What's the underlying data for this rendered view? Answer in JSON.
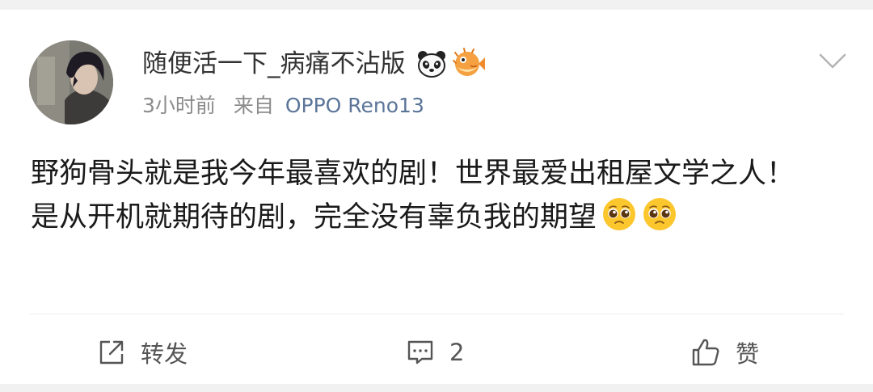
{
  "post": {
    "author": "随便活一下_病痛不沾版",
    "author_badges": [
      "panda-icon",
      "pufferfish-icon"
    ],
    "time": "3小时前",
    "source_prefix": "来自",
    "device": "OPPO Reno13",
    "content_lines": [
      "野狗骨头就是我今年最喜欢的剧！世界最爱出租屋文学之人！",
      "是从开机就期待的剧，完全没有辜负我的期望"
    ],
    "content_emojis": [
      "pleading-face-emoji",
      "pleading-face-emoji"
    ]
  },
  "actions": {
    "repost_label": "转发",
    "comment_count": "2",
    "like_label": "赞"
  },
  "colors": {
    "background": "#f1f1f1",
    "card": "#ffffff",
    "username": "#333333",
    "meta": "#8b8b8b",
    "device_link": "#5b7599",
    "content": "#1a1a1a"
  }
}
